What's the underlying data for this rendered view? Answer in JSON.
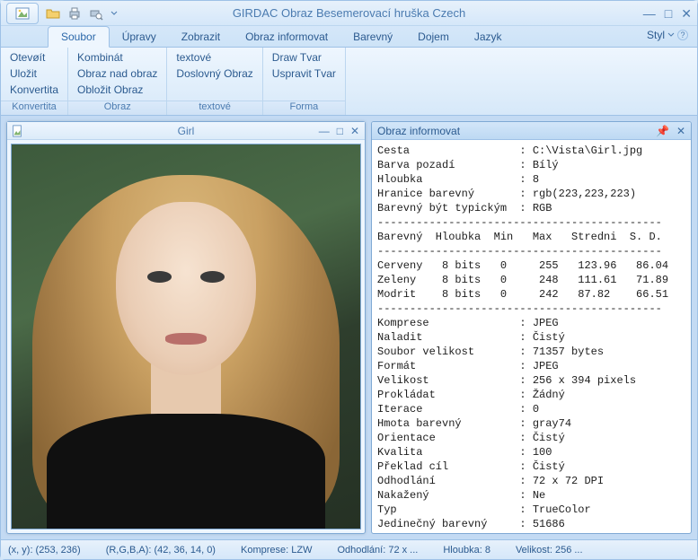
{
  "app": {
    "title": "GIRDAC Obraz Besemerovací hruška Czech",
    "style_label": "Styl"
  },
  "qat": {
    "open": "open-icon",
    "print": "print-icon",
    "preview": "print-preview-icon"
  },
  "tabs": [
    {
      "label": "Soubor",
      "active": true,
      "name": "tab-soubor"
    },
    {
      "label": "Úpravy",
      "active": false,
      "name": "tab-upravy"
    },
    {
      "label": "Zobrazit",
      "active": false,
      "name": "tab-zobrazit"
    },
    {
      "label": "Obraz informovat",
      "active": false,
      "name": "tab-obraz-informovat"
    },
    {
      "label": "Barevný",
      "active": false,
      "name": "tab-barevny"
    },
    {
      "label": "Dojem",
      "active": false,
      "name": "tab-dojem"
    },
    {
      "label": "Jazyk",
      "active": false,
      "name": "tab-jazyk"
    }
  ],
  "ribbon": {
    "groups": [
      {
        "label": "Konvertita",
        "name": "group-konvertita",
        "items": [
          {
            "label": "Otevøít",
            "name": "btn-otevrit"
          },
          {
            "label": "Uložit",
            "name": "btn-ulozit"
          },
          {
            "label": "Konvertita",
            "name": "btn-konvertita"
          }
        ]
      },
      {
        "label": "Obraz",
        "name": "group-obraz",
        "items": [
          {
            "label": "Kombinát",
            "name": "btn-kombinat"
          },
          {
            "label": "Obraz nad obraz",
            "name": "btn-obraz-nad-obraz"
          },
          {
            "label": "Obložit Obraz",
            "name": "btn-oblozit-obraz"
          }
        ]
      },
      {
        "label": "textové",
        "name": "group-textove",
        "items": [
          {
            "label": "textové",
            "name": "btn-textove"
          },
          {
            "label": "Doslovný Obraz",
            "name": "btn-doslovny-obraz"
          }
        ]
      },
      {
        "label": "Forma",
        "name": "group-forma",
        "items": [
          {
            "label": "Draw Tvar",
            "name": "btn-draw-tvar"
          },
          {
            "label": "Uspravit Tvar",
            "name": "btn-uspravit-tvar"
          }
        ]
      }
    ]
  },
  "mdi": {
    "title": "Girl"
  },
  "info": {
    "title": "Obraz informovat",
    "props": [
      {
        "k": "Cesta",
        "v": "C:\\Vista\\Girl.jpg"
      },
      {
        "k": "Barva pozadí",
        "v": "Bílý"
      },
      {
        "k": "Hloubka",
        "v": "8"
      },
      {
        "k": "Hranice barevný",
        "v": "rgb(223,223,223)"
      },
      {
        "k": "Barevný být typickým",
        "v": "RGB"
      }
    ],
    "table_head": "Barevný  Hloubka  Min   Max   Stredni  S. D.",
    "table_rows": [
      "Cerveny   8 bits   0     255   123.96   86.04",
      "Zeleny    8 bits   0     248   111.61   71.89",
      "Modrit    8 bits   0     242   87.82    66.51"
    ],
    "props2": [
      {
        "k": "Komprese",
        "v": "JPEG"
      },
      {
        "k": "Naladit",
        "v": "Čistý"
      },
      {
        "k": "Soubor velikost",
        "v": "71357 bytes"
      },
      {
        "k": "Formát",
        "v": "JPEG"
      },
      {
        "k": "Velikost",
        "v": "256 x 394 pixels"
      },
      {
        "k": "Prokládat",
        "v": "Žádný"
      },
      {
        "k": "Iterace",
        "v": "0"
      },
      {
        "k": "Hmota barevný",
        "v": "gray74"
      },
      {
        "k": "Orientace",
        "v": "Čistý"
      },
      {
        "k": "Kvalita",
        "v": "100"
      },
      {
        "k": "Překlad cíl",
        "v": "Čistý"
      },
      {
        "k": "Odhodlání",
        "v": "72 x 72 DPI"
      },
      {
        "k": "Nakažený",
        "v": "Ne"
      },
      {
        "k": "Typ",
        "v": "TrueColor"
      },
      {
        "k": "Jedinečný barevný",
        "v": "51686"
      }
    ]
  },
  "status": {
    "xy": "(x, y): (253, 236)",
    "rgba": "(R,G,B,A): (42, 36, 14, 0)",
    "compress": "Komprese: LZW",
    "resolution": "Odhodlání: 72 x ...",
    "depth": "Hloubka: 8",
    "size": "Velikost: 256 ..."
  }
}
